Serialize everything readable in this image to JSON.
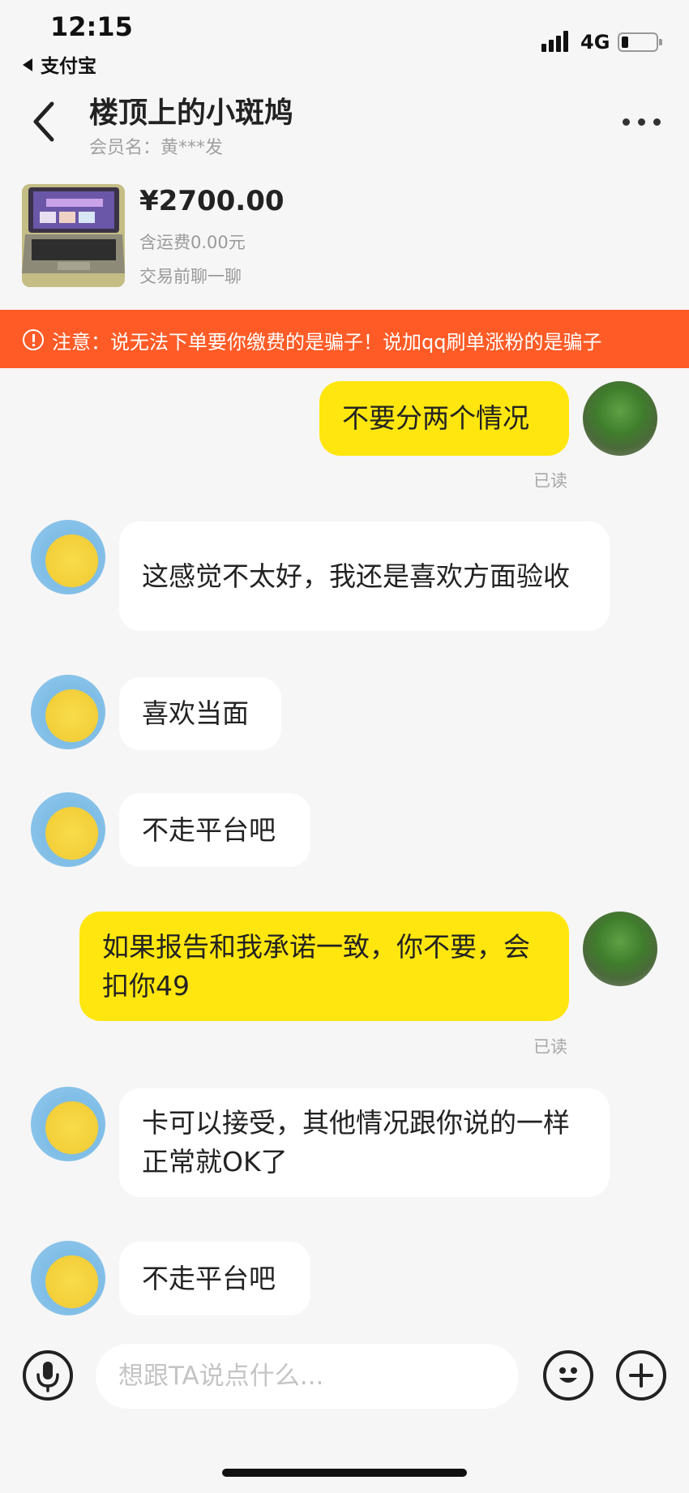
{
  "status_bar": {
    "time": "12:15",
    "back_app": "支付宝",
    "network": "4G",
    "battery_level": 0.2
  },
  "header": {
    "title": "楼顶上的小斑鸠",
    "member_name": "会员名：黄***发"
  },
  "product": {
    "price": "¥2700.00",
    "shipping": "含运费0.00元",
    "hint": "交易前聊一聊"
  },
  "warning": {
    "text": "注意：说无法下单要你缴费的是骗子！说加qq刷单涨粉的是骗子"
  },
  "messages": [
    {
      "sender": "me",
      "text": "不要分两个情况",
      "status": "已读"
    },
    {
      "sender": "them",
      "text": "这感觉不太好，我还是喜欢方面验收"
    },
    {
      "sender": "them",
      "text": "喜欢当面"
    },
    {
      "sender": "them",
      "text": "不走平台吧"
    },
    {
      "sender": "me",
      "text": "如果报告和我承诺一致，你不要，会扣你49",
      "status": "已读"
    },
    {
      "sender": "them",
      "text": "卡可以接受，其他情况跟你说的一样正常就OK了"
    },
    {
      "sender": "them",
      "text": "不走平台吧"
    }
  ],
  "input": {
    "placeholder": "想跟TA说点什么..."
  },
  "icons": {
    "back": "chevron-left-icon",
    "more": "more-dots-icon",
    "warning": "exclamation-circle-icon",
    "voice": "microphone-icon",
    "emoji": "smiley-icon",
    "plus": "plus-icon"
  },
  "colors": {
    "my_bubble": "#ffe60f",
    "their_bubble": "#ffffff",
    "warning_bar": "#ff5b26",
    "background": "#f6f6f6"
  }
}
